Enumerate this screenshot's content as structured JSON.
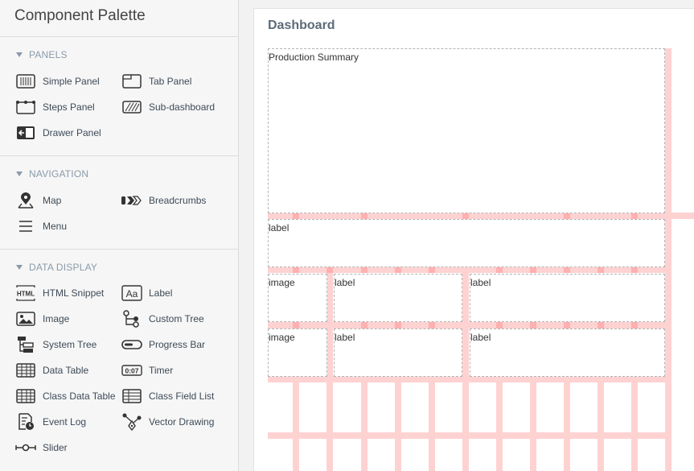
{
  "palette": {
    "title": "Component Palette",
    "sections": [
      {
        "title": "PANELS",
        "items": [
          {
            "label": "Simple Panel",
            "icon": "simple-panel-icon"
          },
          {
            "label": "Tab Panel",
            "icon": "tab-panel-icon"
          },
          {
            "label": "Steps Panel",
            "icon": "steps-panel-icon"
          },
          {
            "label": "Sub-dashboard",
            "icon": "sub-dashboard-icon"
          },
          {
            "label": "Drawer Panel",
            "icon": "drawer-panel-icon"
          }
        ]
      },
      {
        "title": "NAVIGATION",
        "items": [
          {
            "label": "Map",
            "icon": "map-pin-icon"
          },
          {
            "label": "Breadcrumbs",
            "icon": "breadcrumbs-icon"
          },
          {
            "label": "Menu",
            "icon": "menu-icon"
          }
        ]
      },
      {
        "title": "DATA DISPLAY",
        "items": [
          {
            "label": "HTML Snippet",
            "icon": "html-icon"
          },
          {
            "label": "Label",
            "icon": "label-icon"
          },
          {
            "label": "Image",
            "icon": "image-icon"
          },
          {
            "label": "Custom Tree",
            "icon": "custom-tree-icon"
          },
          {
            "label": "System Tree",
            "icon": "system-tree-icon"
          },
          {
            "label": "Progress Bar",
            "icon": "progress-bar-icon"
          },
          {
            "label": "Data Table",
            "icon": "data-table-icon"
          },
          {
            "label": "Timer",
            "icon": "timer-icon"
          },
          {
            "label": "Class Data Table",
            "icon": "class-data-table-icon"
          },
          {
            "label": "Class Field List",
            "icon": "class-field-list-icon"
          },
          {
            "label": "Event Log",
            "icon": "event-log-icon"
          },
          {
            "label": "Vector Drawing",
            "icon": "vector-drawing-icon"
          },
          {
            "label": "Slider",
            "icon": "slider-icon"
          }
        ]
      }
    ]
  },
  "dashboard": {
    "title": "Dashboard",
    "widgets": {
      "summary": "Production Summary",
      "label1": "label",
      "r2_image": "image",
      "r2_label_a": "label",
      "r2_label_b": "label",
      "r3_image": "image",
      "r3_label_a": "label",
      "r3_label_b": "label"
    },
    "timer_icon_text": "0:07",
    "html_icon_text": "HTML"
  },
  "colors": {
    "grid": "#ffd2d2",
    "grid_node": "#ffb0b0",
    "section_header": "#8a9aab"
  }
}
